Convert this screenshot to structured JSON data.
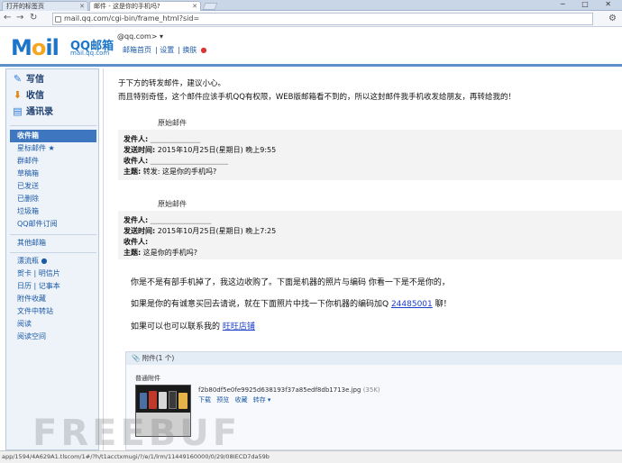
{
  "browser": {
    "tabs": [
      {
        "label": "打开的标签页"
      },
      {
        "label": "邮件 - 这是你的手机吗?"
      }
    ],
    "window_controls": "─ □ ✕",
    "url": "mail.qq.com/cgi-bin/frame_html?sid=",
    "status_text": "app/1594/4A629A1.tlscom/1#/?h/t1acctxmugi/?/e/1/lrm/11449160000/0/29/08IECD7da59b"
  },
  "header": {
    "logo_text": "Mail",
    "logo_text_o": "o",
    "logo_cn": "QQ邮箱",
    "logo_url": "mail.qq.com",
    "user_email": "@qq.com>",
    "links": [
      "邮箱首页",
      "设置",
      "换肤"
    ]
  },
  "sidebar": {
    "top_buttons": [
      {
        "label": "写信",
        "icon": "pencil-icon",
        "glyph": "✎"
      },
      {
        "label": "收信",
        "icon": "inbox-icon",
        "glyph": "⬇"
      },
      {
        "label": "通讯录",
        "icon": "contacts-icon",
        "glyph": "▤"
      }
    ],
    "folders": [
      {
        "label": "收件箱",
        "active": true
      },
      {
        "label": "星标邮件 ★"
      },
      {
        "label": "群邮件"
      },
      {
        "label": "草稿箱"
      },
      {
        "label": "已发送"
      },
      {
        "label": "已删除"
      },
      {
        "label": "垃圾箱"
      },
      {
        "label": "QQ邮件订阅"
      }
    ],
    "folders2": [
      {
        "label": "其他邮箱"
      }
    ],
    "folders3": [
      {
        "label": "漂流瓶 ●"
      },
      {
        "label": "贺卡 | 明信片"
      },
      {
        "label": "日历 | 记事本"
      },
      {
        "label": "附件收藏"
      },
      {
        "label": "文件中转站"
      },
      {
        "label": "阅读"
      },
      {
        "label": "阅读空间"
      }
    ]
  },
  "content": {
    "intro1": "于下方的转发邮件，建议小心。",
    "intro2": "而且特别奇怪，这个邮件应该手机QQ有权限，WEB版邮箱看不到的，所以这封邮件我手机收发给朋友，再转给我的！",
    "fwd1": {
      "label": "原始邮件",
      "sender_label": "发件人:",
      "sender": "",
      "time_label": "发送时间:",
      "time": "2015年10月25日(星期日) 晚上9:55",
      "recipient_label": "收件人:",
      "recipient": "",
      "subject_label": "主题:",
      "subject": "转发: 这是你的手机吗?"
    },
    "fwd2": {
      "label": "原始邮件",
      "sender_label": "发件人:",
      "sender": "",
      "time_label": "发送时间:",
      "time": "2015年10月25日(星期日) 晚上7:25",
      "recipient_label": "收件人:",
      "recipient": "",
      "subject_label": "主题:",
      "subject": "这是你的手机吗?"
    },
    "body1": "你是不是有部手机掉了，我这边收购了。下面是机器的照片与编码 你看一下是不是你的，",
    "body2_pre": "如果是你的有诚意买回去请说，就在下面照片中找一下你机器的编码加Q ",
    "body2_link": "24485001",
    "body2_post": " 聊！",
    "body3_pre": "如果可以也可以联系我的 ",
    "body3_link": "旺旺店铺",
    "attachment": {
      "header": "附件(1 个)",
      "section": "普通附件",
      "filename": "f2b80df5e0fe9925d638193f37a85edf8db1713e.jpg",
      "size": "(35K)",
      "actions": [
        "下载",
        "预览",
        "收藏",
        "转存 ▾"
      ]
    }
  },
  "watermark": "FREEBUF"
}
